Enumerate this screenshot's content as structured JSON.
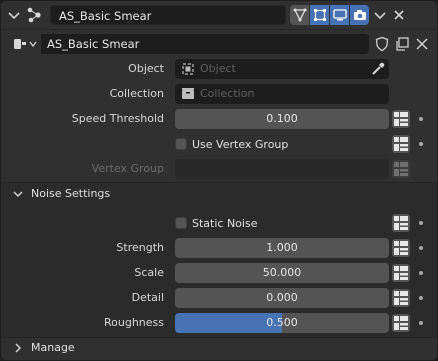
{
  "header": {
    "name": "AS_Basic Smear",
    "icons": [
      "chevron-down-icon",
      "modifier-icon",
      "vertex-icon",
      "editmode-icon",
      "viewport-icon",
      "camera-icon",
      "dropdown-icon",
      "close-icon"
    ]
  },
  "datablock": {
    "name": "AS_Basic Smear",
    "icons": [
      "nodegroup-icon",
      "fake-user-shield-icon",
      "duplicate-icon",
      "unlink-icon"
    ]
  },
  "props": {
    "object": {
      "label": "Object",
      "placeholder": "Object"
    },
    "collection": {
      "label": "Collection",
      "placeholder": "Collection"
    },
    "speed_threshold": {
      "label": "Speed Threshold",
      "value": "0.100"
    },
    "use_vertex_group": {
      "label": "Use Vertex Group",
      "checked": false
    },
    "vertex_group": {
      "label": "Vertex Group"
    }
  },
  "noise": {
    "title": "Noise Settings",
    "static_noise": {
      "label": "Static Noise",
      "checked": false
    },
    "strength": {
      "label": "Strength",
      "value": "1.000"
    },
    "scale": {
      "label": "Scale",
      "value": "50.000"
    },
    "detail": {
      "label": "Detail",
      "value": "0.000"
    },
    "roughness": {
      "label": "Roughness",
      "value": "0.500",
      "fraction": 0.5
    }
  },
  "manage": {
    "title": "Manage"
  },
  "colors": {
    "accent": "#4772b3",
    "panel": "#303030",
    "field": "#545454"
  }
}
